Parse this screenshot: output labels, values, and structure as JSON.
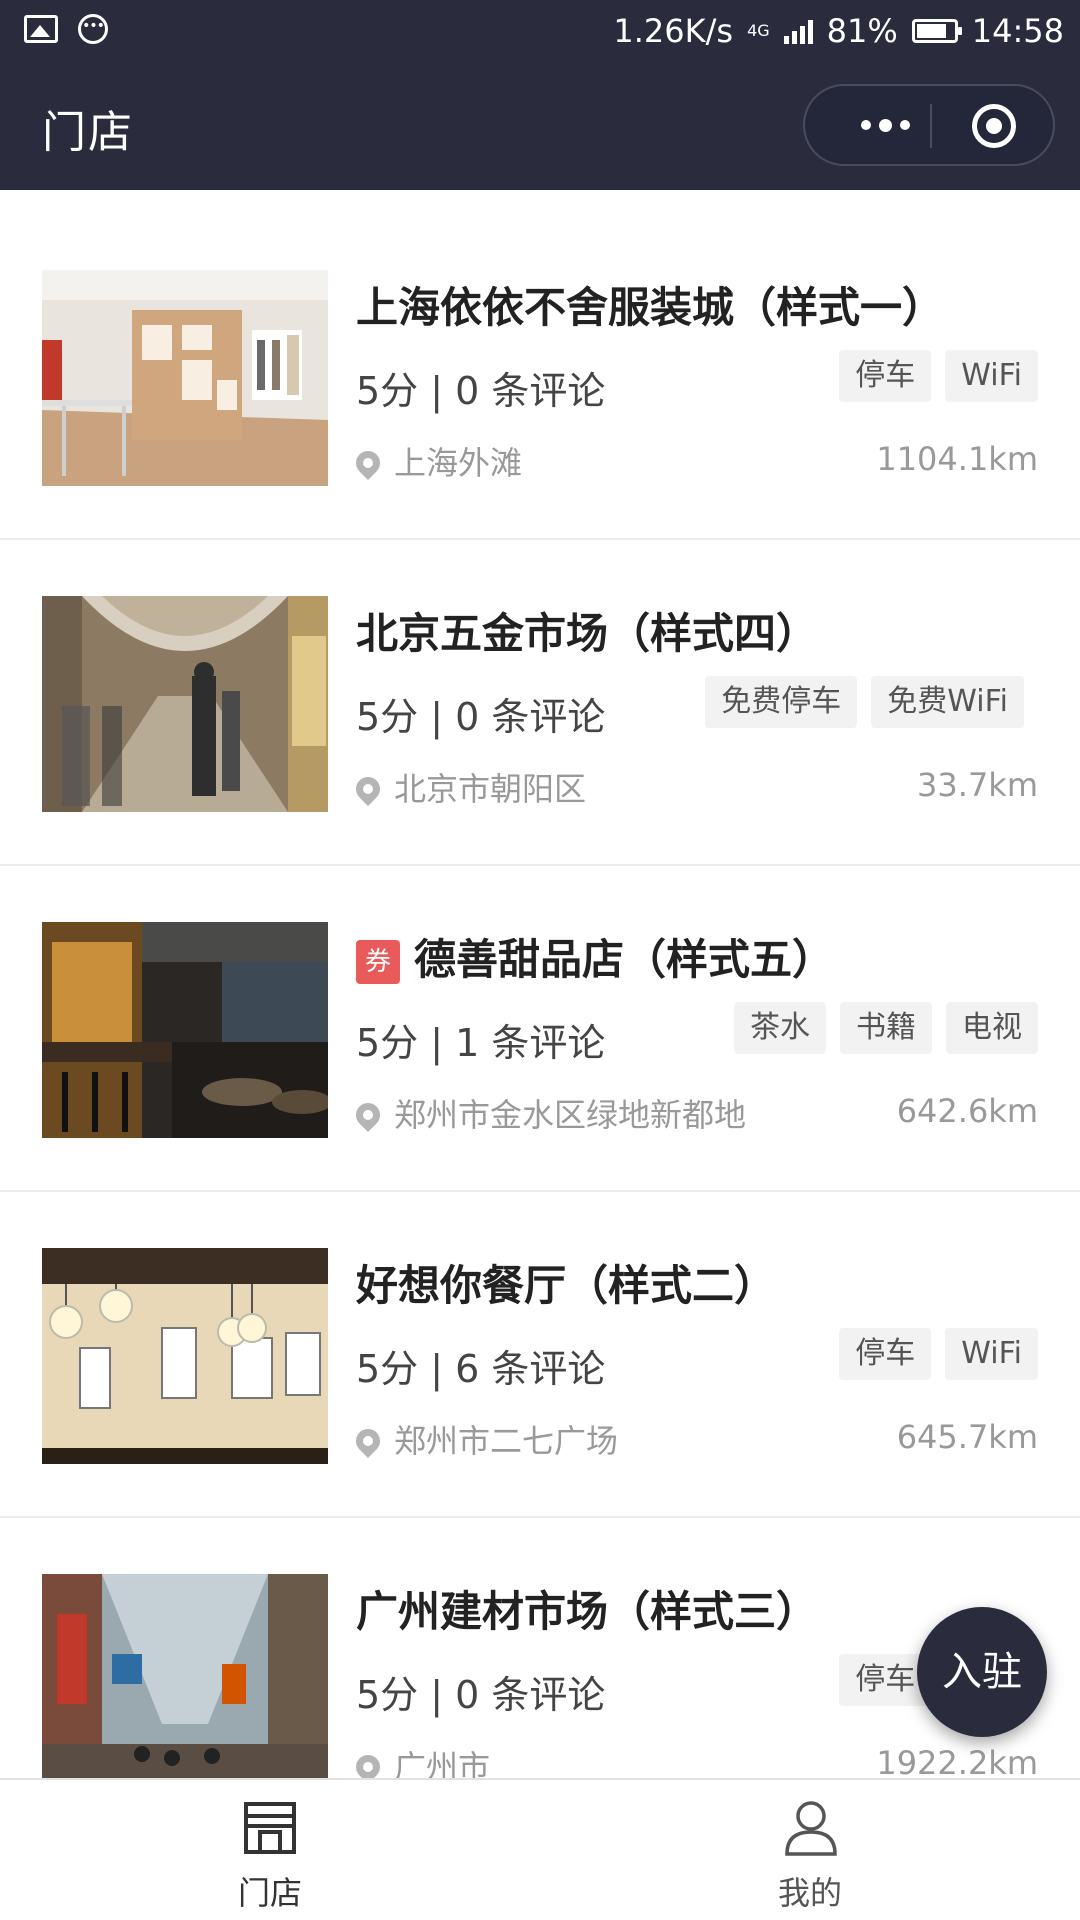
{
  "status_bar": {
    "speed": "1.26K/s",
    "network": "4G",
    "battery": "81%",
    "battery_level": 0.81,
    "time": "14:58"
  },
  "nav": {
    "title": "门店"
  },
  "stores": [
    {
      "title": "上海依依不舍服装城（样式一）",
      "coupon": false,
      "rating": "5分 | 0 条评论",
      "tags": [
        "停车",
        "WiFi"
      ],
      "location": "上海外滩",
      "distance": "1104.1km"
    },
    {
      "title": "北京五金市场（样式四）",
      "coupon": false,
      "rating": "5分 | 0 条评论",
      "tags": [
        "免费停车",
        "免费WiFi"
      ],
      "location": "北京市朝阳区",
      "distance": "33.7km"
    },
    {
      "title": "德善甜品店（样式五）",
      "coupon": true,
      "coupon_label": "券",
      "rating": "5分 | 1 条评论",
      "tags": [
        "茶水",
        "书籍",
        "电视"
      ],
      "location": "郑州市金水区绿地新都地",
      "distance": "642.6km"
    },
    {
      "title": "好想你餐厅（样式二）",
      "coupon": false,
      "rating": "5分 | 6 条评论",
      "tags": [
        "停车",
        "WiFi"
      ],
      "location": "郑州市二七广场",
      "distance": "645.7km"
    },
    {
      "title": "广州建材市场（样式三）",
      "coupon": false,
      "rating": "5分 | 0 条评论",
      "tags": [
        "停车"
      ],
      "location": "广州市",
      "distance": "1922.2km"
    }
  ],
  "fab": {
    "label": "入驻"
  },
  "tabbar": {
    "tabs": [
      {
        "label": "门店"
      },
      {
        "label": "我的"
      }
    ]
  },
  "colors": {
    "header_bg": "#2a2c3e",
    "coupon_red": "#e95a5a",
    "tag_bg": "#f2f2f2"
  }
}
